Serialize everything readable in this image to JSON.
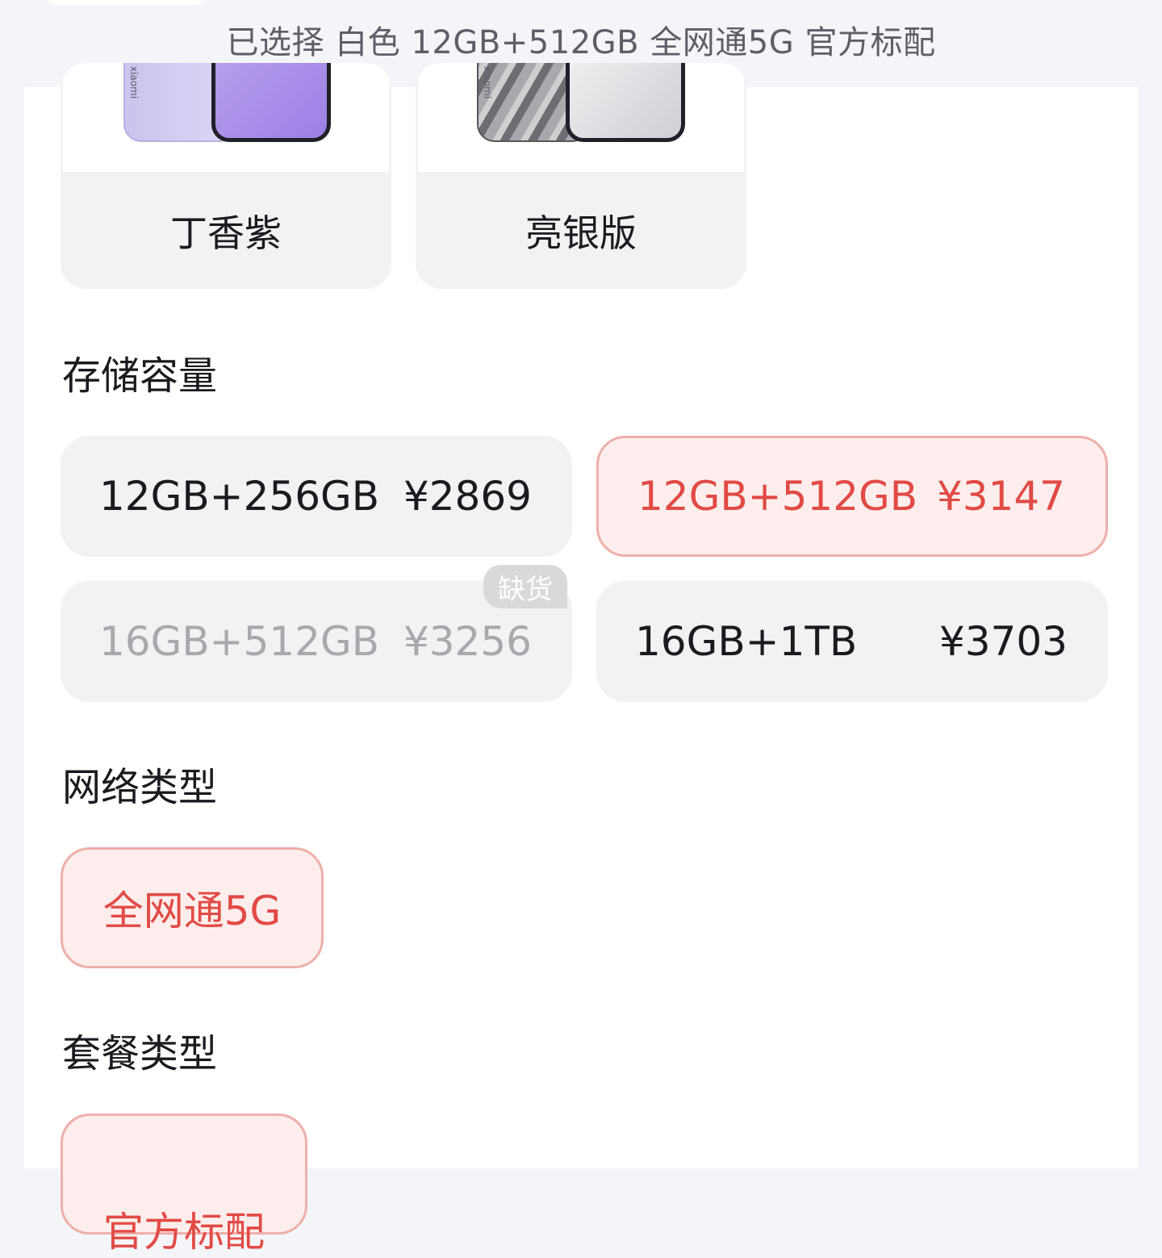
{
  "header": {
    "summary": "已选择 白色 12GB+512GB 全网通5G 官方标配"
  },
  "colors": [
    {
      "label": "丁香紫",
      "brand": "xiaomi"
    },
    {
      "label": "亮银版",
      "brand": "xiaomi"
    }
  ],
  "storage": {
    "title": "存储容量",
    "options": [
      {
        "spec": "12GB+256GB",
        "price": "¥2869",
        "state": "normal"
      },
      {
        "spec": "12GB+512GB",
        "price": "¥3147",
        "state": "selected"
      },
      {
        "spec": "16GB+512GB",
        "price": "¥3256",
        "state": "disabled",
        "badge": "缺货"
      },
      {
        "spec": "16GB+1TB",
        "price": "¥3703",
        "state": "normal"
      }
    ]
  },
  "network": {
    "title": "网络类型",
    "options": [
      {
        "label": "全网通5G",
        "state": "selected"
      }
    ]
  },
  "package": {
    "title": "套餐类型",
    "options": [
      {
        "label": "官方标配",
        "state": "selected"
      }
    ]
  },
  "colors_palette": {
    "accent": "#e24a44",
    "accent_bg": "#fdeeed",
    "accent_border": "#eeafaa",
    "option_bg": "#f2f2f4"
  }
}
